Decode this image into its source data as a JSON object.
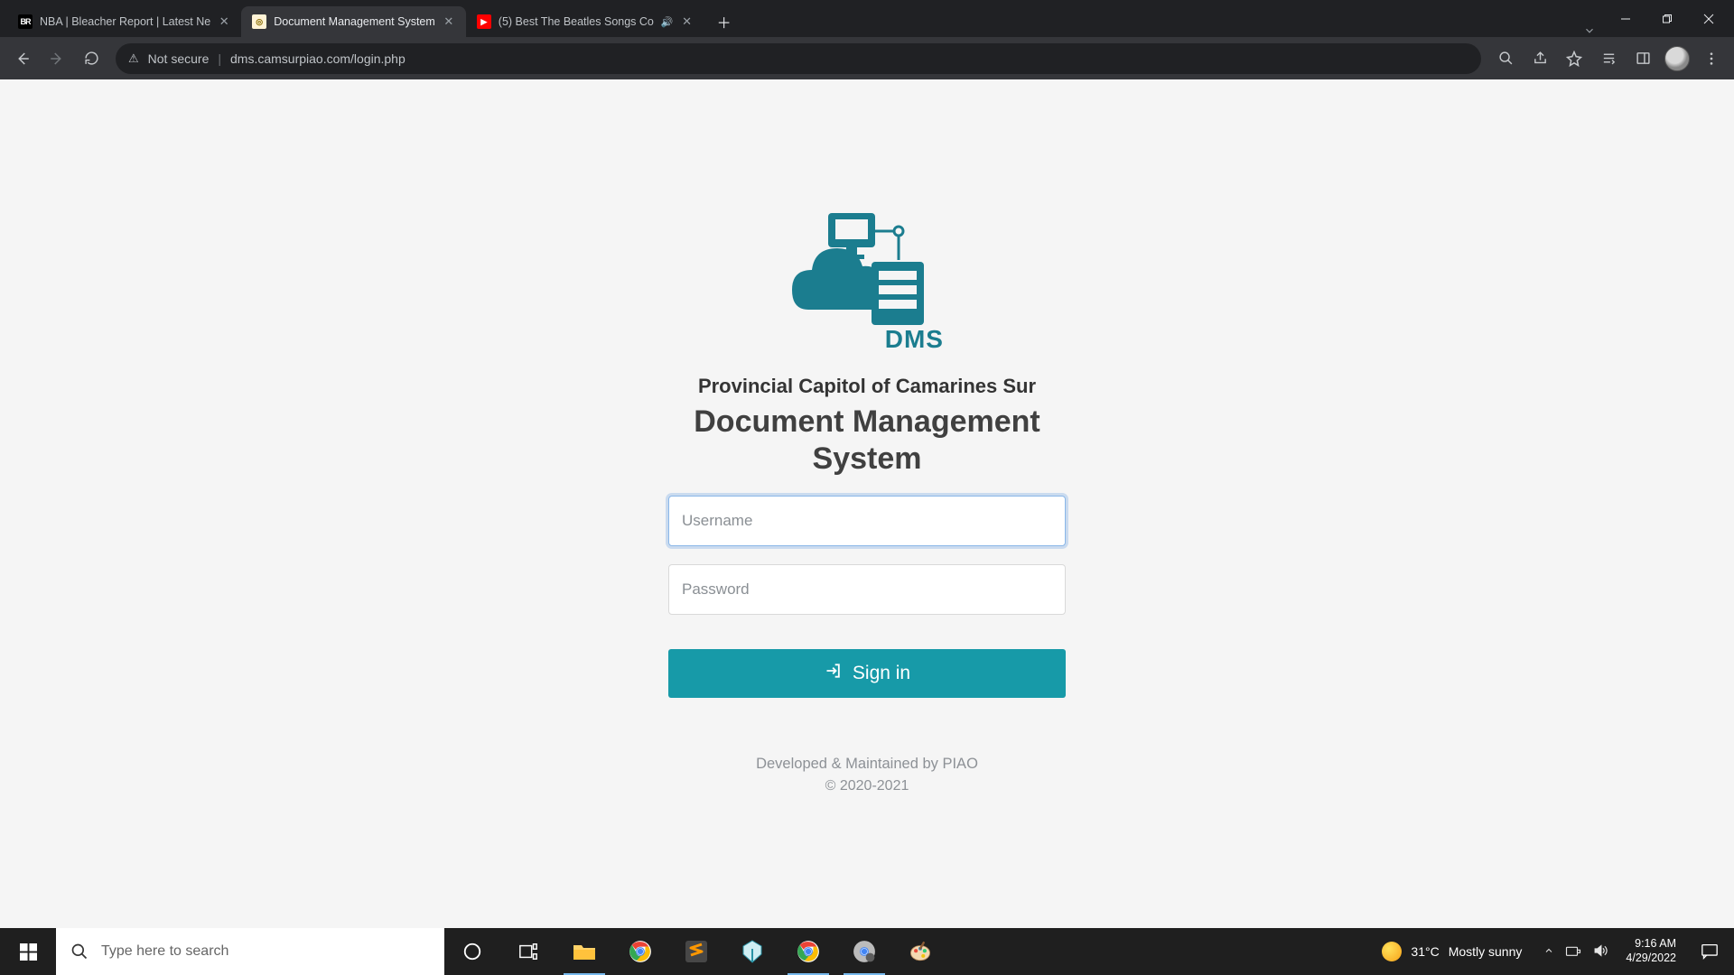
{
  "browser": {
    "tabs": [
      {
        "title": "NBA | Bleacher Report | Latest Ne"
      },
      {
        "title": "Document Management System"
      },
      {
        "title": "(5) Best The Beatles Songs Co"
      }
    ],
    "security_label": "Not secure",
    "url": "dms.camsurpiao.com/login.php"
  },
  "page": {
    "logo_label": "DMS",
    "subtitle": "Provincial Capitol of Camarines Sur",
    "title": "Document Management System",
    "username_placeholder": "Username",
    "password_placeholder": "Password",
    "signin_label": "Sign in",
    "footer_dev": "Developed & Maintained by PIAO",
    "footer_copy": "© 2020-2021"
  },
  "taskbar": {
    "search_placeholder": "Type here to search",
    "weather_temp": "31°C",
    "weather_desc": "Mostly sunny",
    "time": "9:16 AM",
    "date": "4/29/2022"
  }
}
